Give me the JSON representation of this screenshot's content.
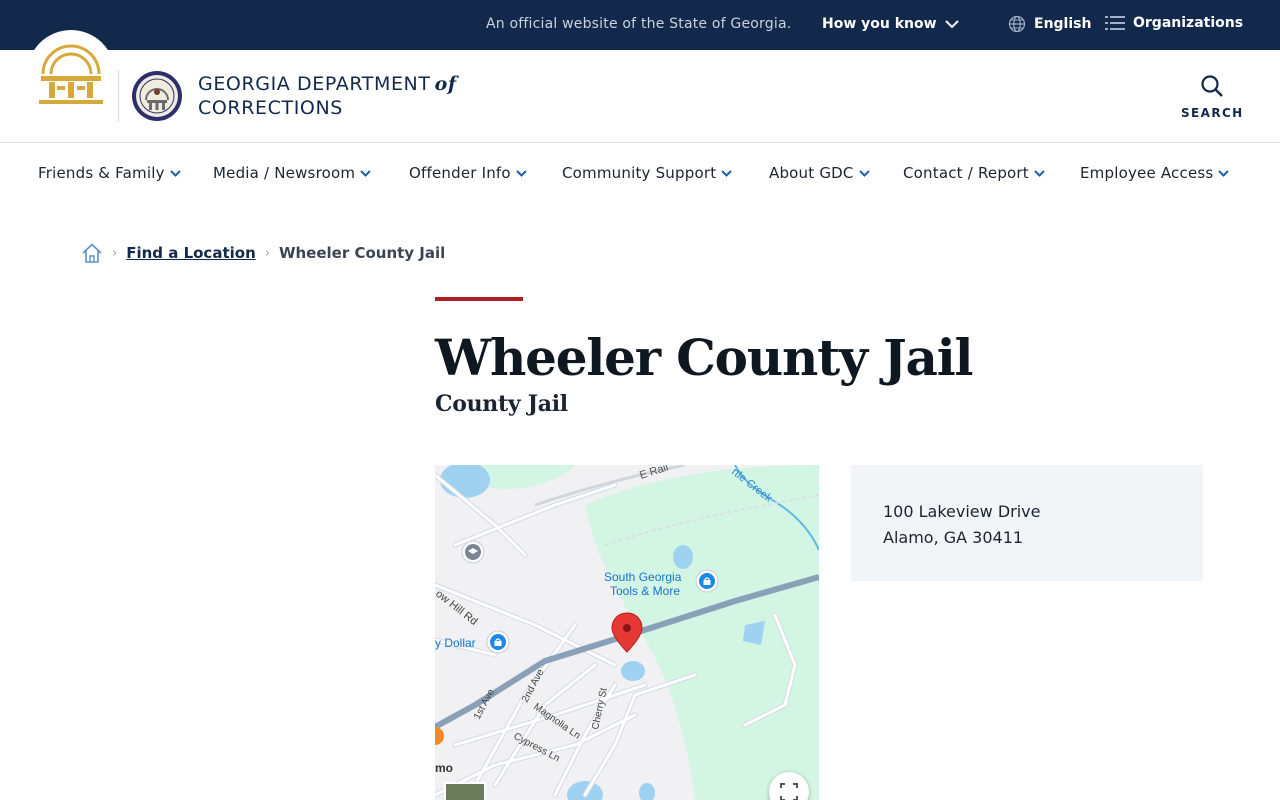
{
  "topbar": {
    "official_text": "An official website of the State of Georgia.",
    "how_you_know": "How you know",
    "language": "English",
    "organizations": "Organizations"
  },
  "header": {
    "agency_line1": "GEORGIA DEPARTMENT",
    "agency_of": "of",
    "agency_line2": "CORRECTIONS",
    "search_label": "SEARCH"
  },
  "nav": {
    "items": [
      {
        "label": "Friends & Family"
      },
      {
        "label": "Media / Newsroom"
      },
      {
        "label": "Offender Info"
      },
      {
        "label": "Community Support"
      },
      {
        "label": "About GDC"
      },
      {
        "label": "Contact / Report"
      },
      {
        "label": "Employee Access"
      }
    ]
  },
  "breadcrumb": {
    "home_icon": "home-icon",
    "link": "Find a Location",
    "current": "Wheeler County Jail"
  },
  "page": {
    "title": "Wheeler County Jail",
    "subtitle": "County Jail"
  },
  "map": {
    "labels": {
      "business": "South Georgia\nTools & More",
      "business_line1": "South Georgia",
      "business_line2": "Tools & More",
      "dollar": "y Dollar",
      "road_hill": "ow Hill Rd",
      "creek": "rtle Creek",
      "rail": "E Rail",
      "ave1": "1st Ave",
      "ave2": "2nd Ave",
      "magnolia": "Magnolia Ln",
      "cherry": "Cherry St",
      "cypress": "Cypress Ln",
      "mo": "mo"
    },
    "colors": {
      "water": "#9fd2f0",
      "park": "#d3f5e3",
      "road": "#ffffff",
      "highway": "#8aa0b8",
      "pin": "#e53935"
    }
  },
  "address": {
    "line1": "100 Lakeview Drive",
    "line2": "Alamo, GA 30411"
  },
  "colors": {
    "navy": "#13294b",
    "accent_red": "#b01c24",
    "gold": "#d6a93a"
  }
}
